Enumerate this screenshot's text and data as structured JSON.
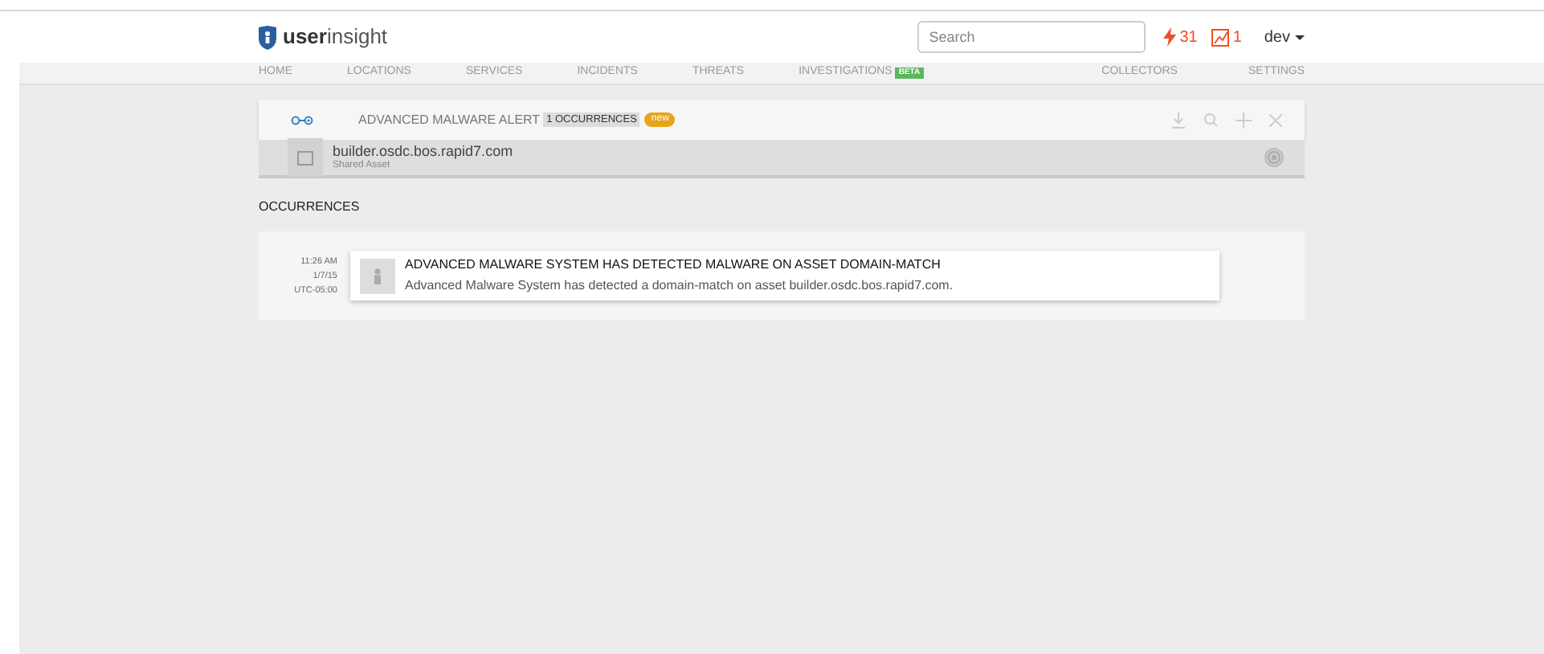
{
  "header": {
    "logo": {
      "bold": "user",
      "light": "insight"
    },
    "search": {
      "placeholder": "Search"
    },
    "alerts_count": "31",
    "incidents_count": "1",
    "user": "dev"
  },
  "nav": {
    "left": [
      {
        "label": "HOME"
      },
      {
        "label": "LOCATIONS"
      },
      {
        "label": "SERVICES"
      },
      {
        "label": "INCIDENTS"
      },
      {
        "label": "THREATS"
      },
      {
        "label": "INVESTIGATIONS",
        "badge": "BETA"
      }
    ],
    "right": [
      {
        "label": "COLLECTORS"
      },
      {
        "label": "SETTINGS"
      }
    ]
  },
  "alert": {
    "title": "ADVANCED MALWARE ALERT",
    "occurrences_badge": "1 OCCURRENCES",
    "new_badge": "new",
    "asset": {
      "name": "builder.osdc.bos.rapid7.com",
      "subtitle": "Shared Asset"
    }
  },
  "occurrences": {
    "heading": "OCCURRENCES",
    "items": [
      {
        "time": "11:26 AM",
        "date": "1/7/15",
        "timezone": "UTC-05:00",
        "title": "ADVANCED MALWARE SYSTEM HAS DETECTED MALWARE ON ASSET DOMAIN-MATCH",
        "description": "Advanced Malware System has detected a domain-match on asset builder.osdc.bos.rapid7.com."
      }
    ]
  }
}
